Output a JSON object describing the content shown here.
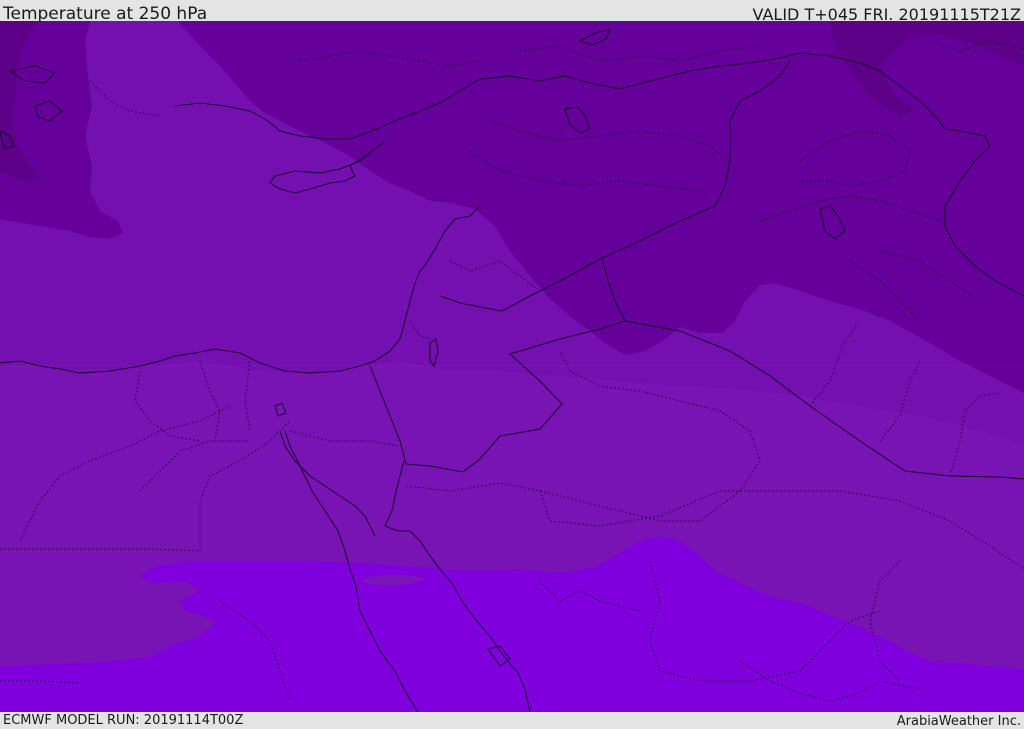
{
  "header": {
    "title": "Temperature at 250 hPa",
    "valid": "VALID T+045 FRI. 20191115T21Z"
  },
  "footer": {
    "model_run": "ECMWF MODEL RUN: 20191114T00Z",
    "credit": "ArabiaWeather Inc."
  },
  "map": {
    "colors": {
      "band_coldest": "#5d0088",
      "band_cold": "#65009a",
      "band_mid": "#7510b0",
      "band_warm": "#7a16b8",
      "band_warmest": "#7f00dc",
      "boundary": "#1a0830"
    }
  }
}
